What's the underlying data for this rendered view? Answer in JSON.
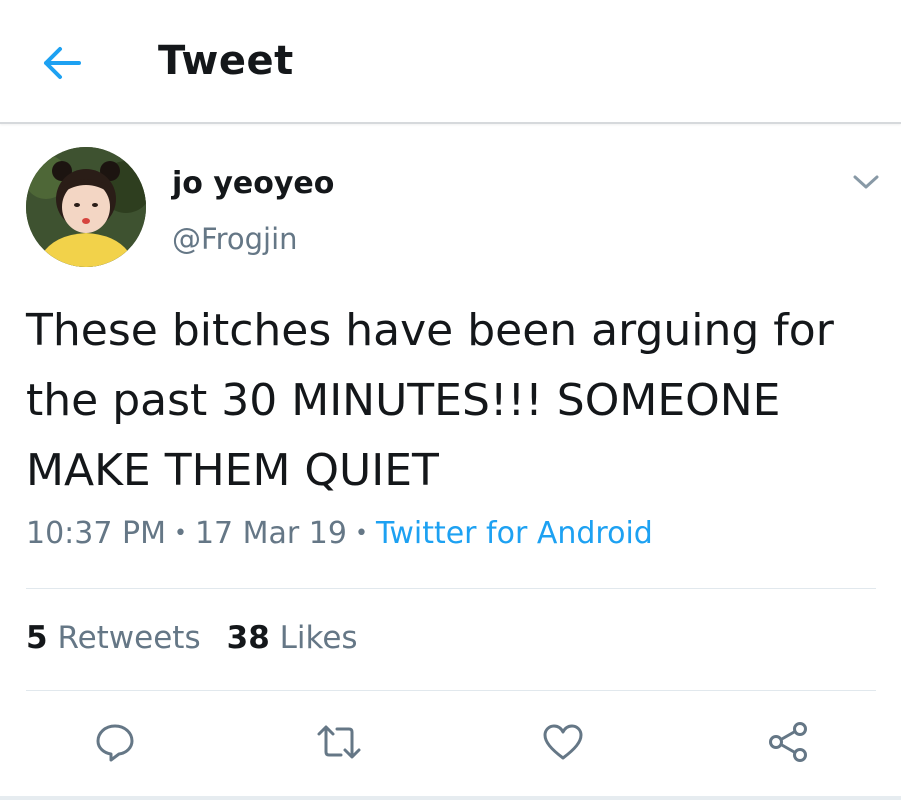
{
  "header": {
    "title": "Tweet",
    "back_icon": "arrow-left-icon",
    "accent": "#1da1f2"
  },
  "tweet": {
    "display_name": "jo yeoyeo",
    "handle": "@Frogjin",
    "text": "These bitches have been arguing for the past 30 MINUTES!!! SOMEONE MAKE THEM QUIET",
    "time": "10:37 PM",
    "date": "17 Mar 19",
    "source": "Twitter for Android",
    "separator": "•"
  },
  "stats": {
    "retweets_count": "5",
    "retweets_label": "Retweets",
    "likes_count": "38",
    "likes_label": "Likes"
  },
  "actions": [
    {
      "name": "reply",
      "icon": "speech-bubble-icon"
    },
    {
      "name": "retweet",
      "icon": "retweet-icon"
    },
    {
      "name": "like",
      "icon": "heart-icon"
    },
    {
      "name": "share",
      "icon": "share-icon"
    }
  ],
  "colors": {
    "text": "#14171a",
    "secondary": "#657786",
    "link": "#1da1f2",
    "divider": "#e1e8ed"
  }
}
